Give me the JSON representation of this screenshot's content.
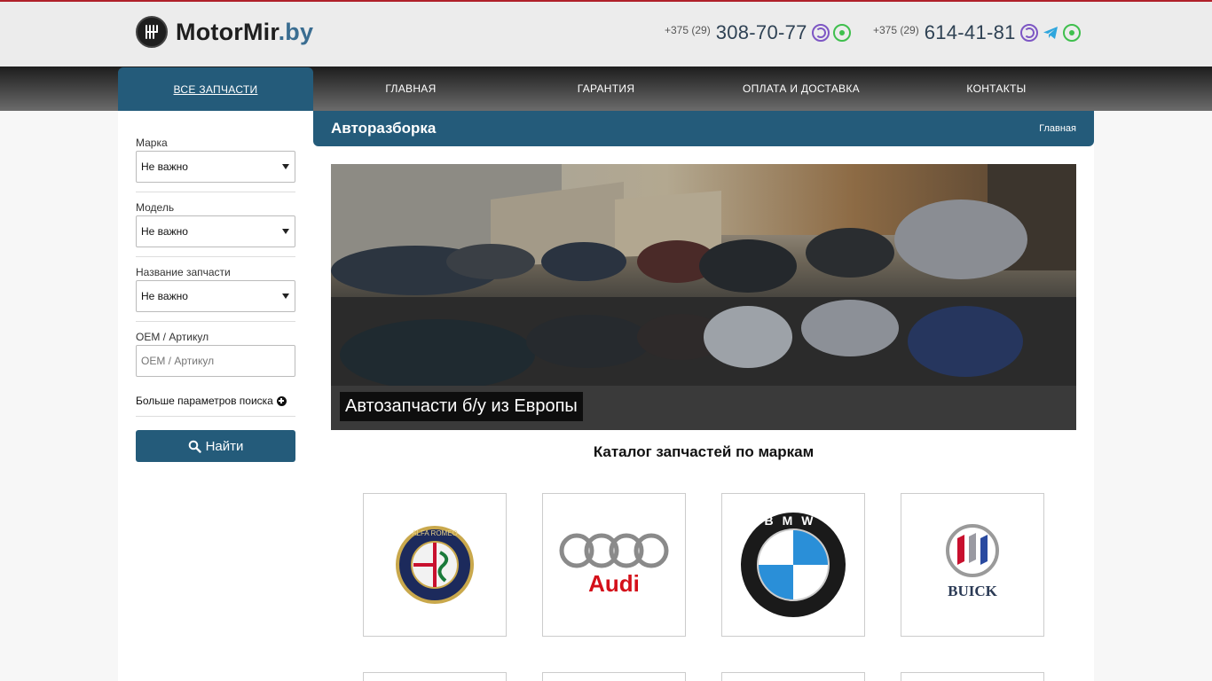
{
  "header": {
    "logo_text": "MotorMir",
    "logo_domain": ".by",
    "phones": [
      {
        "code": "+375 (29)",
        "number": "308-70-77",
        "messengers": [
          "viber-icon",
          "whatsapp-icon"
        ]
      },
      {
        "code": "+375 (29)",
        "number": "614-41-81",
        "messengers": [
          "viber-icon",
          "telegram-icon",
          "whatsapp-icon"
        ]
      }
    ]
  },
  "nav": {
    "items": [
      {
        "label": "ВСЕ ЗАПЧАСТИ",
        "active": true
      },
      {
        "label": "ГЛАВНАЯ",
        "active": false
      },
      {
        "label": "ГАРАНТИЯ",
        "active": false
      },
      {
        "label": "ОПЛАТА И ДОСТАВКА",
        "active": false
      },
      {
        "label": "КОНТАКТЫ",
        "active": false
      }
    ]
  },
  "sidebar": {
    "brand_label": "Марка",
    "brand_value": "Не важно",
    "model_label": "Модель",
    "model_value": "Не важно",
    "part_label": "Название запчасти",
    "part_value": "Не важно",
    "oem_label": "OEM / Артикул",
    "oem_placeholder": "OEM / Артикул",
    "more_label": "Больше параметров поиска",
    "search_label": "Найти"
  },
  "page": {
    "title": "Авторазборка",
    "breadcrumb": "Главная",
    "banner_caption": "Автозапчасти б/у из Европы",
    "catalog_title": "Каталог запчастей по маркам"
  },
  "brands": [
    {
      "name": "Alfa Romeo",
      "logo_text": "ALFA ROMEO",
      "icon": "alfa-romeo-logo"
    },
    {
      "name": "Audi",
      "logo_text": "Audi",
      "icon": "audi-logo"
    },
    {
      "name": "BMW",
      "logo_text": "BMW",
      "icon": "bmw-logo"
    },
    {
      "name": "Buick",
      "logo_text": "BUICK",
      "icon": "buick-logo"
    }
  ],
  "colors": {
    "accent": "#245b7a",
    "topline": "#b0202a",
    "viber": "#7d56c4",
    "whatsapp": "#3fbf4d",
    "telegram": "#2ea6dd"
  }
}
